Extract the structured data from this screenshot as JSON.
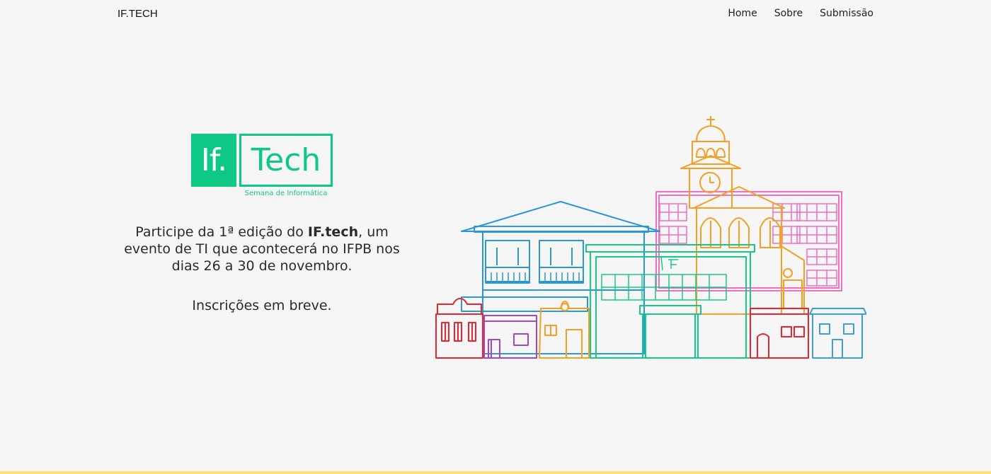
{
  "nav": {
    "brand": "IF.TECH",
    "links": [
      "Home",
      "Sobre",
      "Submissão"
    ]
  },
  "logo": {
    "left_text": "If.",
    "right_text": "Tech",
    "subtitle": "Semana de Informática",
    "color": "#0dc984"
  },
  "intro": {
    "part1": "Participe da 1ª edição do ",
    "bold": "IF.tech",
    "part2": ", um evento de TI que acontecerá no IFPB nos dias 26 a 30 de novembro."
  },
  "soon": "Inscrições em breve.",
  "illustration": {
    "building_sign": "IF",
    "colors": {
      "blue": "#2a97d9",
      "pink": "#f06fc0",
      "orange": "#f5a021",
      "green": "#16c98a",
      "red": "#e8262f",
      "purple": "#a346c8",
      "light_blue": "#3b9fd8"
    }
  },
  "bottom_bar_color": "#fae279"
}
